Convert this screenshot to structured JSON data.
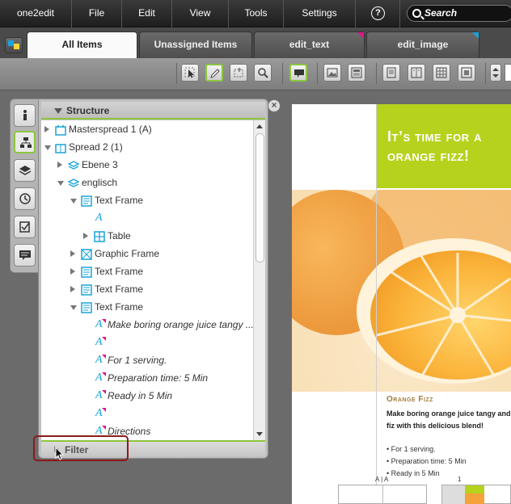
{
  "app": {
    "title": "one2edit"
  },
  "menu": {
    "file": "File",
    "edit": "Edit",
    "view": "View",
    "tools": "Tools",
    "settings": "Settings",
    "help": "?"
  },
  "search": {
    "label": "Search"
  },
  "tabs": [
    {
      "label": "All Items",
      "active": true
    },
    {
      "label": "Unassigned Items",
      "active": false
    },
    {
      "label": "edit_text",
      "active": false,
      "corner_color": "#e0168d"
    },
    {
      "label": "edit_image",
      "active": false,
      "corner_color": "#1aa3d9"
    }
  ],
  "structure": {
    "title": "Structure",
    "rows": [
      {
        "label": "Masterspread 1 (A)",
        "icon": "masterspread-icon",
        "twisty": "closed"
      },
      {
        "label": "Spread 2 (1)",
        "icon": "spread-icon",
        "twisty": "open"
      },
      {
        "label": "Ebene 3",
        "icon": "layer-icon",
        "twisty": "closed"
      },
      {
        "label": "englisch",
        "icon": "layer-icon",
        "twisty": "open"
      },
      {
        "label": "Text Frame",
        "icon": "text-frame-icon",
        "twisty": "open"
      },
      {
        "label": "",
        "icon": "text-icon",
        "twisty": "none"
      },
      {
        "label": "Table",
        "icon": "table-icon",
        "twisty": "closed"
      },
      {
        "label": "Graphic Frame",
        "icon": "graphic-frame-icon",
        "twisty": "closed"
      },
      {
        "label": "Text Frame",
        "icon": "text-frame-icon",
        "twisty": "closed"
      },
      {
        "label": "Text Frame",
        "icon": "text-frame-icon",
        "twisty": "closed"
      },
      {
        "label": "Text Frame",
        "icon": "text-frame-icon",
        "twisty": "open"
      },
      {
        "label": "Make boring orange juice tangy ...",
        "icon": "text-icon",
        "twisty": "none"
      },
      {
        "label": "",
        "icon": "text-icon",
        "twisty": "none"
      },
      {
        "label": "For 1 serving.",
        "icon": "text-icon",
        "twisty": "none"
      },
      {
        "label": "Preparation time: 5 Min",
        "icon": "text-icon",
        "twisty": "none"
      },
      {
        "label": "Ready in 5 Min",
        "icon": "text-icon",
        "twisty": "none"
      },
      {
        "label": "",
        "icon": "text-icon",
        "twisty": "none"
      },
      {
        "label": "Directions",
        "icon": "text-icon",
        "twisty": "none"
      }
    ]
  },
  "filter": {
    "label": "Filter"
  },
  "document": {
    "headline_line1": "It’s time for a",
    "headline_line2": "orange fizz!",
    "subheading": "Orange Fizz",
    "intro": "Make boring orange juice tangy and fiz with this delicious blend!",
    "bullets": [
      "• For 1 serving.",
      "• Preparation time: 5 Min",
      "• Ready in 5 Min"
    ],
    "page_label": "A | A",
    "page_number": "1"
  },
  "colors": {
    "accent": "#8cc63f",
    "text_icon": "#1aa3d9",
    "marker": "#e0168d",
    "banner": "#b7d21c"
  }
}
